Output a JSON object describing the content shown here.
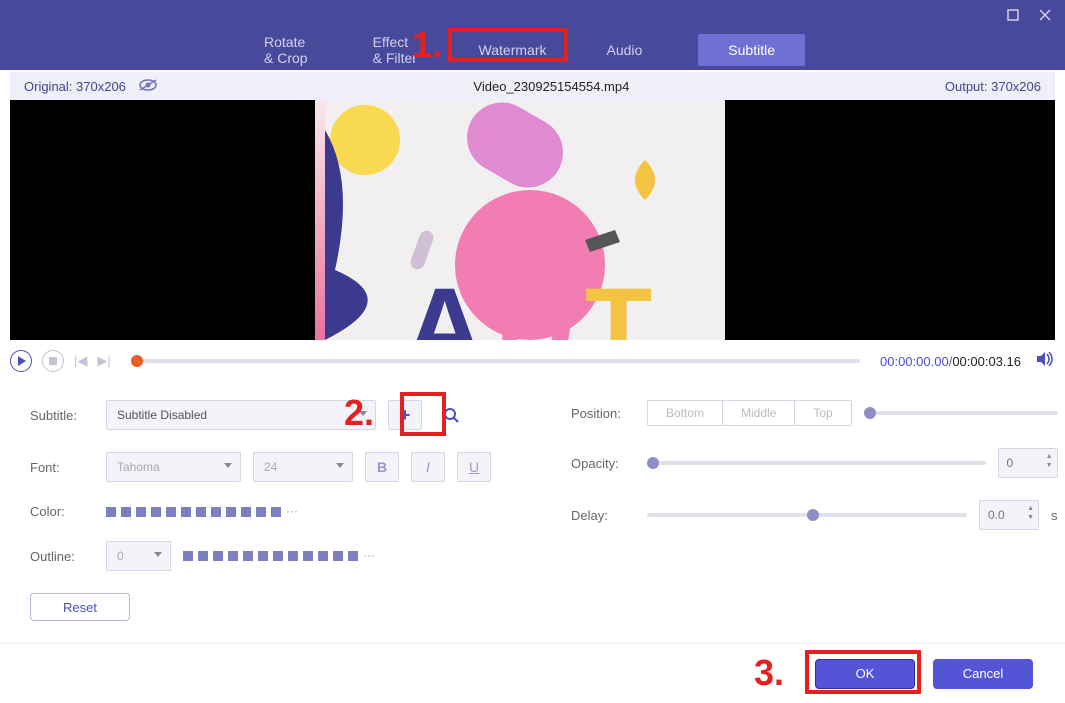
{
  "window": {
    "maximize": "▢",
    "close": "✕"
  },
  "tabs": {
    "rotate": "Rotate & Crop",
    "effect": "Effect & Filter",
    "watermark": "Watermark",
    "audio": "Audio",
    "subtitle": "Subtitle"
  },
  "info": {
    "original_label": "Original: 370x206",
    "filename": "Video_230925154554.mp4",
    "output_label": "Output: 370x206"
  },
  "playback": {
    "current": "00:00:00.00",
    "duration": "00:00:03.16",
    "sep": "/"
  },
  "subtitle": {
    "label": "Subtitle:",
    "selected": "Subtitle Disabled",
    "font_label": "Font:",
    "font_name": "Tahoma",
    "font_size": "24",
    "bold": "B",
    "italic": "I",
    "underline": "U",
    "color_label": "Color:",
    "outline_label": "Outline:",
    "outline_val": "0",
    "reset": "Reset",
    "more": "···"
  },
  "position": {
    "label": "Position:",
    "bottom": "Bottom",
    "middle": "Middle",
    "top": "Top",
    "opacity_label": "Opacity:",
    "opacity_val": "0",
    "delay_label": "Delay:",
    "delay_val": "0.0",
    "delay_unit": "s"
  },
  "footer": {
    "ok": "OK",
    "cancel": "Cancel"
  },
  "annotations": {
    "n1": "1.",
    "n2": "2.",
    "n3": "3."
  }
}
